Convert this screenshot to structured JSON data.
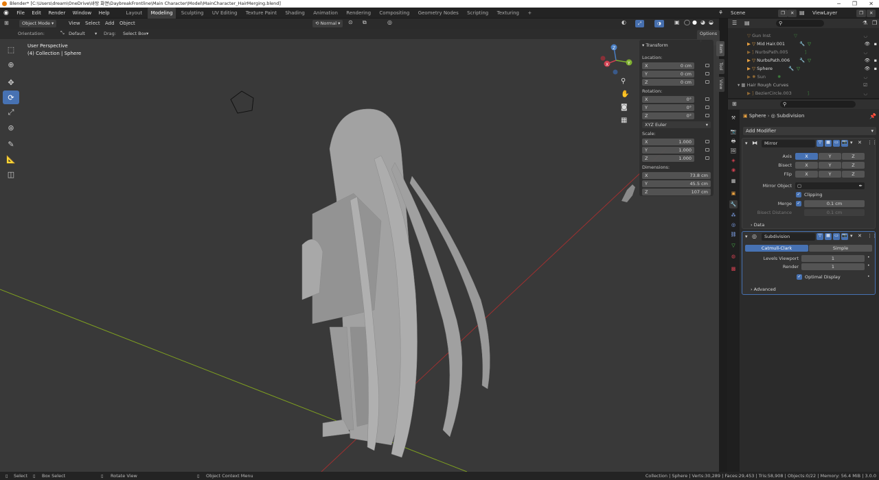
{
  "title_bar": {
    "title": "Blender* [C:\\Users\\dream\\OneDrive\\바탕 화면\\DaybreakFrontline\\Main Character\\Model\\MainCharacter_HairMerging.blend]"
  },
  "menu": {
    "items": [
      "File",
      "Edit",
      "Render",
      "Window",
      "Help"
    ]
  },
  "workspaces": {
    "tabs": [
      "Layout",
      "Modeling",
      "Sculpting",
      "UV Editing",
      "Texture Paint",
      "Shading",
      "Animation",
      "Rendering",
      "Compositing",
      "Geometry Nodes",
      "Scripting",
      "Texturing"
    ],
    "active": "Modeling",
    "add": "+"
  },
  "top_right": {
    "scene": "Scene",
    "view_layer": "ViewLayer"
  },
  "viewport_header": {
    "mode": "Object Mode",
    "view": "View",
    "select": "Select",
    "add": "Add",
    "object": "Object",
    "orientation_mode": "Normal"
  },
  "tool_options": {
    "orientation_label": "Orientation:",
    "orientation_value": "Default",
    "drag_label": "Drag:",
    "drag_value": "Select Box",
    "options": "Options"
  },
  "viewport_info": {
    "line1": "User Perspective",
    "line2": "(4) Collection | Sphere"
  },
  "npanel": {
    "tabs": [
      "Item",
      "Tool",
      "View"
    ],
    "section": "Transform",
    "location_label": "Location:",
    "location": {
      "x": "0 cm",
      "y": "0 cm",
      "z": "0 cm"
    },
    "rotation_label": "Rotation:",
    "rotation": {
      "x": "0°",
      "y": "0°",
      "z": "0°"
    },
    "rotation_mode": "XYZ Euler",
    "scale_label": "Scale:",
    "scale": {
      "x": "1.000",
      "y": "1.000",
      "z": "1.000"
    },
    "dimensions_label": "Dimensions:",
    "dimensions": {
      "x": "73.8 cm",
      "y": "45.5 cm",
      "z": "107 cm"
    },
    "axis_labels": {
      "x": "X",
      "y": "Y",
      "z": "Z"
    }
  },
  "outliner": {
    "rows": [
      "Gun Inst",
      "Mid Hair.001",
      "NurbsPath.005",
      "NurbsPath.006",
      "Sphere",
      "Sun",
      "Hair Rough Curves",
      "BezierCircle.003"
    ]
  },
  "properties": {
    "breadcrumb_object": "Sphere",
    "breadcrumb_modifier": "Subdivision",
    "add_modifier": "Add Modifier",
    "mirror": {
      "name": "Mirror",
      "axis_label": "Axis",
      "bisect_label": "Bisect",
      "flip_label": "Flip",
      "x": "X",
      "y": "Y",
      "z": "Z",
      "mirror_object_label": "Mirror Object",
      "clipping": "Clipping",
      "merge_label": "Merge",
      "merge_value": "0.1 cm",
      "bisect_distance_label": "Bisect Distance",
      "bisect_distance_value": "0.1 cm",
      "data": "Data"
    },
    "subdivision": {
      "name": "Subdivision",
      "catmull": "Catmull-Clark",
      "simple": "Simple",
      "levels_viewport_label": "Levels Viewport",
      "levels_viewport": "1",
      "render_label": "Render",
      "render": "1",
      "optimal_display": "Optimal Display",
      "advanced": "Advanced"
    }
  },
  "status_bar": {
    "select": "Select",
    "box_select": "Box Select",
    "rotate": "Rotate View",
    "context": "Object Context Menu",
    "stats": "Collection | Sphere | Verts:30,289 | Faces:29,453 | Tris:58,908 | Objects:0/22 | Memory: 56.4 MiB | 3.0.0"
  },
  "colors": {
    "accent": "#4772b3",
    "viewport": "#393939",
    "panel": "#2b2b2b"
  }
}
